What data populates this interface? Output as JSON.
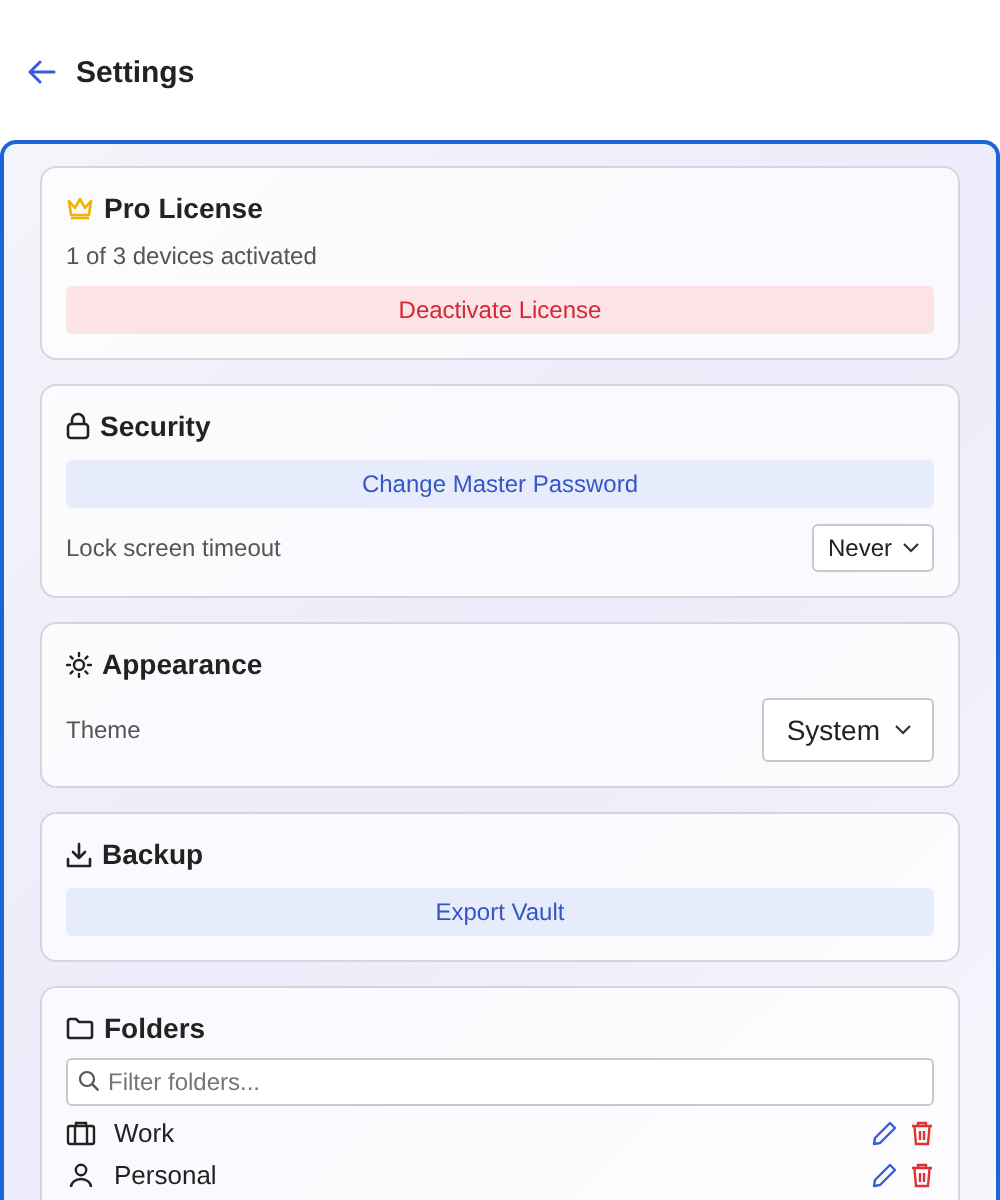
{
  "header": {
    "title": "Settings"
  },
  "sections": [
    {
      "kind": "license",
      "title": "Pro License",
      "rows": [
        {
          "kind": "note",
          "text": "1 of 3 devices activated"
        },
        {
          "kind": "danger-button",
          "label": "Deactivate License"
        }
      ]
    },
    {
      "kind": "security",
      "title": "Security",
      "rows": [
        {
          "kind": "button",
          "label": "Change Master Password"
        },
        {
          "kind": "select",
          "label": "Lock screen timeout",
          "value": "Never"
        }
      ]
    },
    {
      "kind": "appearance",
      "title": "Appearance",
      "rows": [
        {
          "kind": "select-large",
          "label": "Theme",
          "value": "System"
        }
      ]
    },
    {
      "kind": "backup",
      "title": "Backup",
      "rows": [
        {
          "kind": "button",
          "label": "Export Vault"
        }
      ]
    },
    {
      "kind": "folders",
      "title": "Folders",
      "rows": [
        {
          "kind": "search",
          "placeholder": "Filter folders..."
        },
        {
          "kind": "folder",
          "name": "Work"
        },
        {
          "kind": "folder",
          "name": "Personal"
        }
      ]
    }
  ]
}
